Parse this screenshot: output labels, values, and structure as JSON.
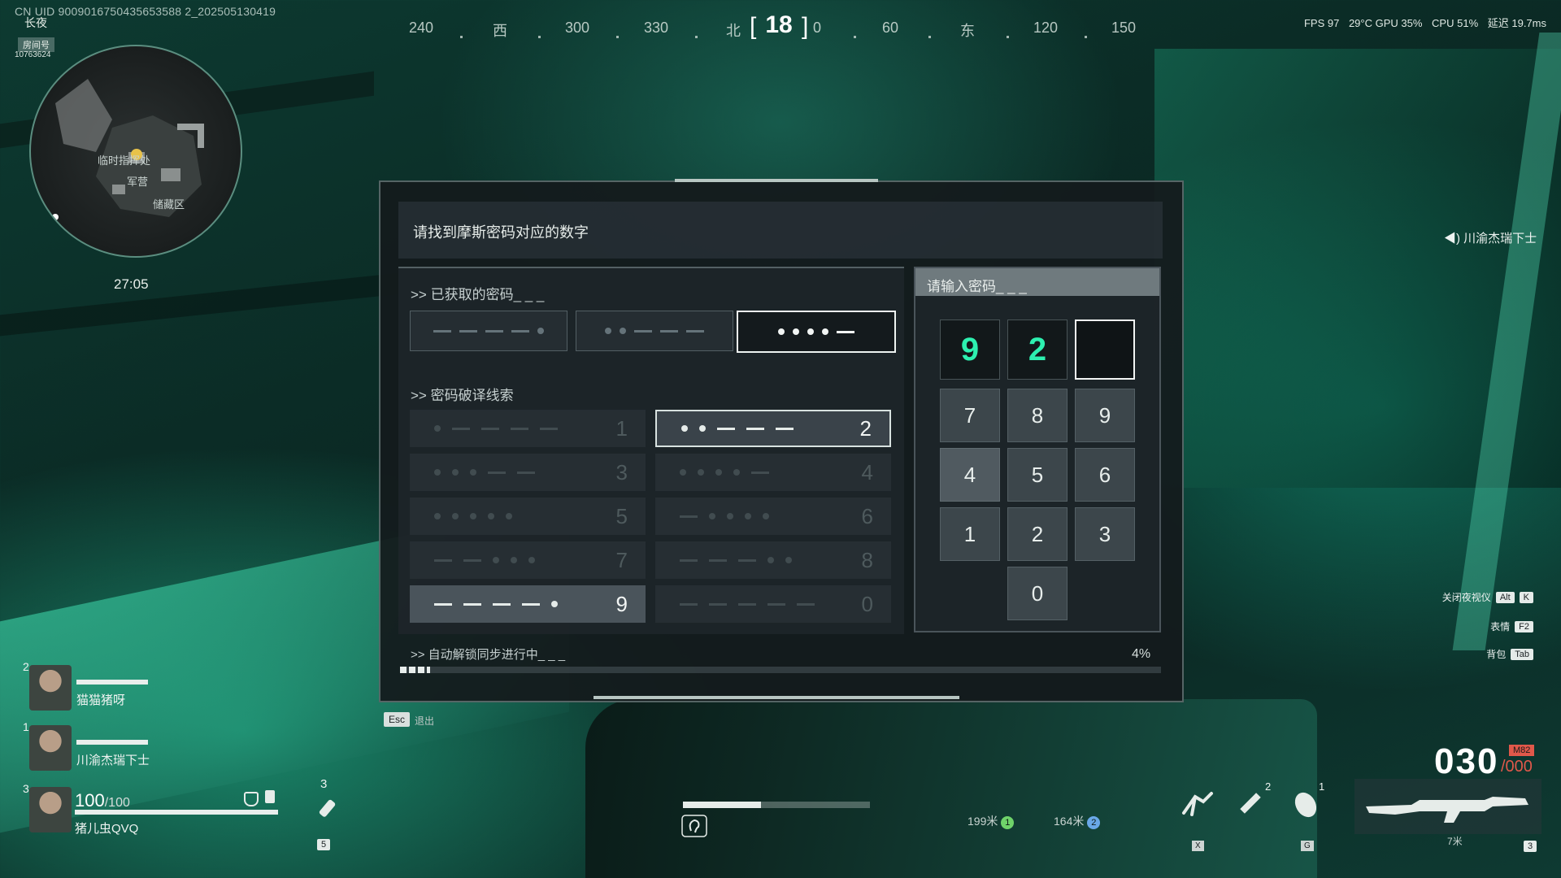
{
  "hud": {
    "uid": "CN UID 9009016750435653588 2_202505130419",
    "season_tag": "长夜",
    "room_label": "房间号",
    "room_number": "10763624",
    "map_timer": "27:05",
    "map_labels": [
      "临时指挥处",
      "军营",
      "储藏区"
    ],
    "stats": [
      "FPS 97",
      "29°C GPU 35%",
      "CPU 51%",
      "延迟 19.7ms"
    ]
  },
  "compass": {
    "heading": "18",
    "ticks": [
      "240",
      "西",
      "300",
      "330",
      "北",
      "0",
      "60",
      "东",
      "120",
      "150"
    ]
  },
  "modal": {
    "title": "请找到摩斯密码对应的数字",
    "obtained_label": ">> 已获取的密码_ _ _",
    "clues_label": ">> 密码破译线索",
    "obtained_codes": [
      {
        "pattern": "----.",
        "active": false
      },
      {
        "pattern": "..---",
        "active": false
      },
      {
        "pattern": "....-",
        "active": true
      }
    ],
    "clues": [
      {
        "pattern": ".----",
        "digit": "1",
        "state": "dim"
      },
      {
        "pattern": "..---",
        "digit": "2",
        "state": "active"
      },
      {
        "pattern": "...--",
        "digit": "3",
        "state": "dim"
      },
      {
        "pattern": "....-",
        "digit": "4",
        "state": "dim"
      },
      {
        "pattern": ".....",
        "digit": "5",
        "state": "dim"
      },
      {
        "pattern": "-....",
        "digit": "6",
        "state": "dim"
      },
      {
        "pattern": "--...",
        "digit": "7",
        "state": "dim"
      },
      {
        "pattern": "---..",
        "digit": "8",
        "state": "dim"
      },
      {
        "pattern": "----.",
        "digit": "9",
        "state": "selected"
      },
      {
        "pattern": "-----",
        "digit": "0",
        "state": "dim"
      }
    ],
    "input_label": "请输入密码_ _ _",
    "entered_digits": [
      "9",
      "2",
      ""
    ],
    "keypad": [
      "7",
      "8",
      "9",
      "4",
      "5",
      "6",
      "1",
      "2",
      "3",
      "0"
    ],
    "progress_label": ">> 自动解锁同步进行中_ _ _",
    "progress_value": "4%",
    "progress_fraction": 0.04,
    "esc_key": "Esc",
    "esc_label": "退出"
  },
  "speaker": "川渝杰瑞下士",
  "hotkeys": [
    {
      "label": "关闭夜视仪",
      "keys": [
        "Alt",
        "K"
      ]
    },
    {
      "label": "表情",
      "keys": [
        "F2"
      ]
    },
    {
      "label": "背包",
      "keys": [
        "Tab"
      ]
    }
  ],
  "squad": [
    {
      "index": "2",
      "name": "猫猫猪呀"
    },
    {
      "index": "1",
      "name": "川渝杰瑞下士"
    }
  ],
  "self": {
    "index": "3",
    "hp": "100",
    "hp_max": "/100",
    "name": "猪儿虫QVQ",
    "grenade_count": "3",
    "grenade_key": "5"
  },
  "markers": [
    {
      "distance": "199米",
      "badge": "1",
      "color": "#6fd36a"
    },
    {
      "distance": "164米",
      "badge": "2",
      "color": "#6aa8e8"
    }
  ],
  "loadout": {
    "ammo": "030",
    "ammo_reserve": "/000",
    "weapon": "M82",
    "range": "7米",
    "skill_counts": [
      "2",
      "1"
    ],
    "skill_keys": [
      "X",
      "G"
    ],
    "weapon_key": "3"
  },
  "colors": {
    "accent": "#2df0b0",
    "panel": "#1e262a",
    "ammo_warning": "#e0584a"
  }
}
